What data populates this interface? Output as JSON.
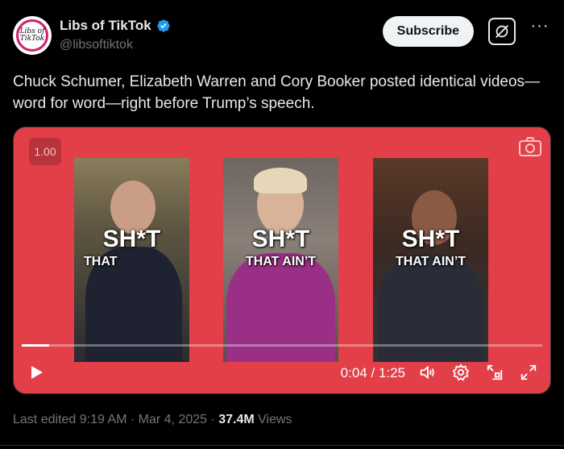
{
  "account": {
    "display_name": "Libs of TikTok",
    "handle": "@libsoftiktok",
    "avatar_text": "Libs of TikTok"
  },
  "actions": {
    "subscribe_label": "Subscribe",
    "grok_icon": "grok-icon",
    "more_icon": "more-icon"
  },
  "post": {
    "text": "Chuck Schumer, Elizabeth Warren and Cory Booker posted identical videos—word for word—right before Trump’s speech."
  },
  "video": {
    "speed": "1.00",
    "progress": 0.053,
    "time": "0:04 / 1:25",
    "panels": [
      {
        "caption_big": "SH*T",
        "caption_small": "THAT"
      },
      {
        "caption_big": "SH*T",
        "caption_small": "THAT AIN’T"
      },
      {
        "caption_big": "SH*T",
        "caption_small": "THAT AIN’T"
      }
    ],
    "colors": {
      "background": "#e23f48"
    }
  },
  "meta": {
    "edited": "Last edited 9:19 AM · Mar 4, 2025 · ",
    "views_count": "37.4M",
    "views_label": " Views"
  }
}
